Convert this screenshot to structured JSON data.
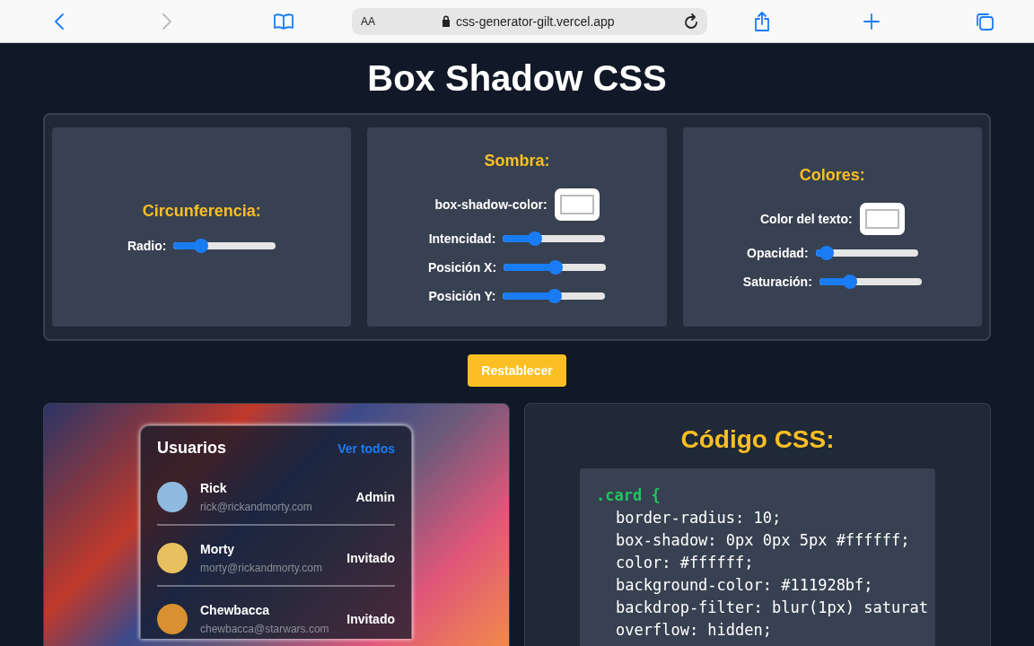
{
  "browser": {
    "text_size": "AA",
    "url": "css-generator-gilt.vercel.app",
    "forward_disabled": true
  },
  "title": "Box Shadow CSS",
  "control_cards": [
    {
      "heading": "Circunferencia:",
      "rows": [
        {
          "kind": "slider",
          "label": "Radio:",
          "level": 0.23
        }
      ]
    },
    {
      "heading": "Sombra:",
      "rows": [
        {
          "kind": "color",
          "label": "box-shadow-color:",
          "color": "#ffffff"
        },
        {
          "kind": "slider",
          "label": "Intencidad:",
          "level": 0.28
        },
        {
          "kind": "slider",
          "label": "Posición X:",
          "level": 0.51
        },
        {
          "kind": "slider",
          "label": "Posición Y:",
          "level": 0.51
        }
      ]
    },
    {
      "heading": "Colores:",
      "rows": [
        {
          "kind": "color",
          "label": "Color del texto:",
          "color": "#ffffff"
        },
        {
          "kind": "slider",
          "label": "Opacidad:",
          "level": 0.05
        },
        {
          "kind": "slider",
          "label": "Saturación:",
          "level": 0.27
        }
      ]
    }
  ],
  "reset_button": "Restablecer",
  "preview": {
    "title": "Usuarios",
    "link": "Ver todos",
    "users": [
      {
        "name": "Rick",
        "email": "rick@rickandmorty.com",
        "role": "Admin"
      },
      {
        "name": "Morty",
        "email": "morty@rickandmorty.com",
        "role": "Invitado"
      },
      {
        "name": "Chewbacca",
        "email": "chewbacca@starwars.com",
        "role": "Invitado"
      }
    ]
  },
  "code": {
    "title": "Código CSS:",
    "selector": ".card {",
    "lines": [
      "border-radius: 10;",
      "box-shadow: 0px 0px 5px #ffffff;",
      "color: #ffffff;",
      "background-color: #111928bf;",
      "backdrop-filter: blur(1px) saturat",
      "overflow: hidden;"
    ]
  }
}
